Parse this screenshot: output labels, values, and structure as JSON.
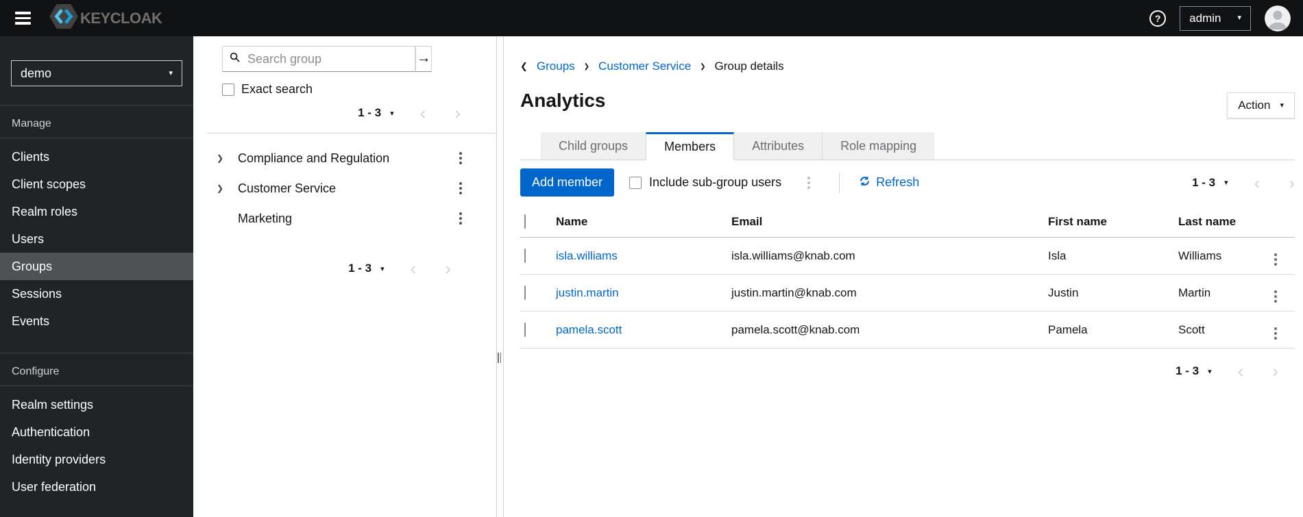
{
  "colors": {
    "primary_blue": "#0066cc",
    "masthead_bg": "#111214",
    "sidebar_bg": "#212427",
    "sidebar_active_bg": "#4f5255",
    "tab_inactive_bg": "#f0f0f0",
    "link_blue": "#0066cc"
  },
  "icons": {
    "caret-down": "▾",
    "chevron-left": "‹",
    "chevron-right": "›",
    "back-chevron": "❮",
    "breadcrumb-separator": "❯",
    "tree-expand": "❯",
    "arrow-right": "→",
    "help": "?"
  },
  "masthead": {
    "brand": "KEYCLOAK",
    "user_menu": {
      "label": "admin"
    }
  },
  "sidebar": {
    "realm_selector": {
      "value": "demo"
    },
    "sections": [
      {
        "label": "Manage",
        "items": [
          {
            "label": "Clients"
          },
          {
            "label": "Client scopes"
          },
          {
            "label": "Realm roles"
          },
          {
            "label": "Users"
          },
          {
            "label": "Groups"
          },
          {
            "label": "Sessions"
          },
          {
            "label": "Events"
          }
        ]
      },
      {
        "label": "Configure",
        "items": [
          {
            "label": "Realm settings"
          },
          {
            "label": "Authentication"
          },
          {
            "label": "Identity providers"
          },
          {
            "label": "User federation"
          }
        ]
      }
    ]
  },
  "groups_panel": {
    "search": {
      "placeholder": "Search group"
    },
    "exact_search_label": "Exact search",
    "pagination_top": {
      "range": "1 - 3"
    },
    "tree": [
      {
        "label": "Compliance and Regulation"
      },
      {
        "label": "Customer Service"
      },
      {
        "label": "Marketing"
      }
    ],
    "pagination_bottom": {
      "range": "1 - 3"
    }
  },
  "main": {
    "breadcrumb": {
      "items": [
        {
          "label": "Groups"
        },
        {
          "label": "Customer Service"
        },
        {
          "label": "Group details"
        }
      ]
    },
    "title": "Analytics",
    "action_button": "Action",
    "tabs": [
      {
        "label": "Child groups"
      },
      {
        "label": "Members"
      },
      {
        "label": "Attributes"
      },
      {
        "label": "Role mapping"
      }
    ],
    "toolbar": {
      "add_member": "Add member",
      "include_subgroups": "Include sub-group users",
      "refresh": "Refresh",
      "pagination": {
        "range": "1 - 3"
      }
    },
    "table": {
      "headers": [
        "Name",
        "Email",
        "First name",
        "Last name"
      ],
      "rows": [
        {
          "name": "isla.williams",
          "email": "isla.williams@knab.com",
          "first_name": "Isla",
          "last_name": "Williams"
        },
        {
          "name": "justin.martin",
          "email": "justin.martin@knab.com",
          "first_name": "Justin",
          "last_name": "Martin"
        },
        {
          "name": "pamela.scott",
          "email": "pamela.scott@knab.com",
          "first_name": "Pamela",
          "last_name": "Scott"
        }
      ]
    },
    "pagination_bottom": {
      "range": "1 - 3"
    }
  }
}
